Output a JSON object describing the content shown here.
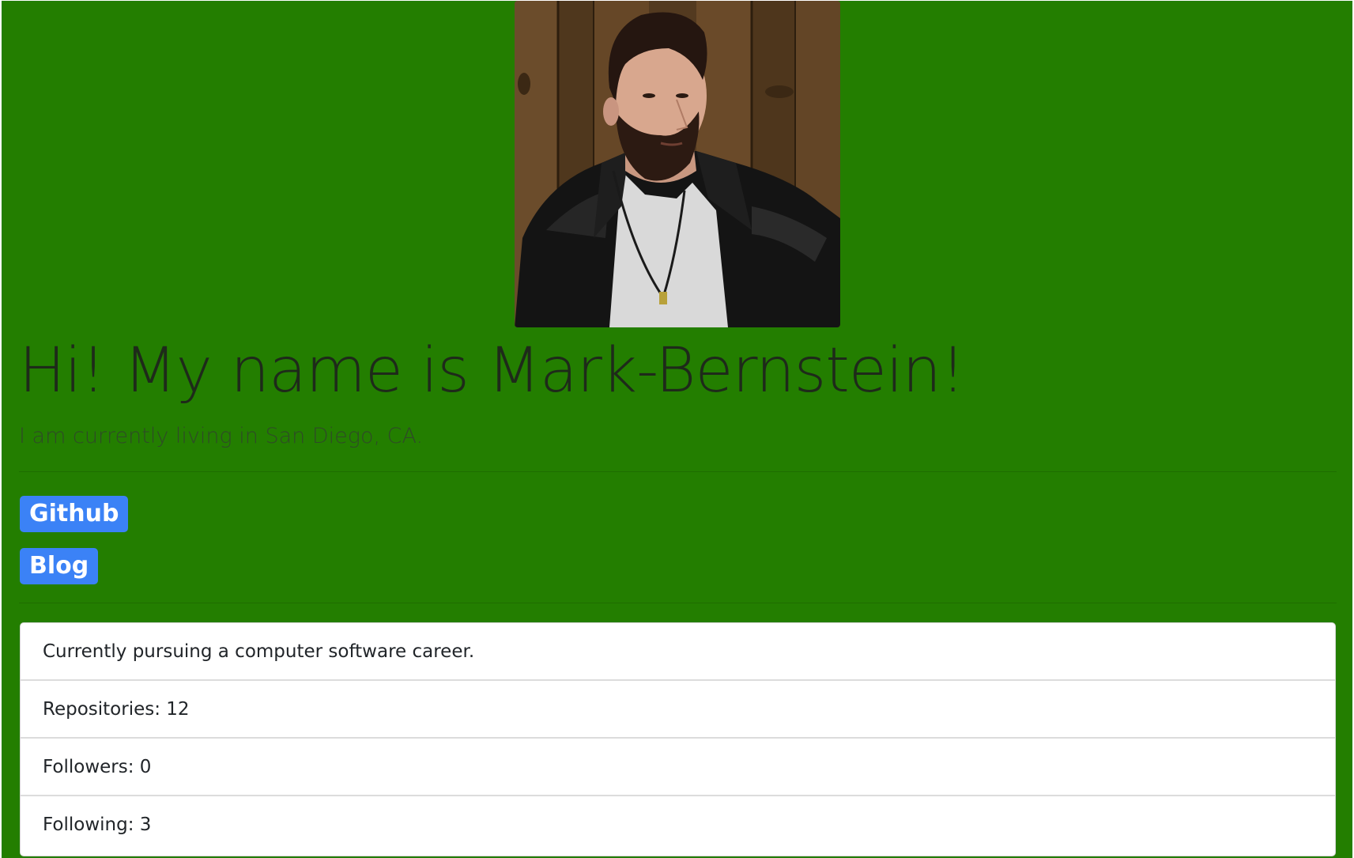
{
  "profile": {
    "photo_alt": "profile photo",
    "headline": "Hi! My name is Mark-Bernstein!",
    "location": "I am currently living in San Diego, CA."
  },
  "links": {
    "github_label": "Github",
    "blog_label": "Blog"
  },
  "details": {
    "items": [
      "Currently pursuing a computer software career.",
      "Repositories: 12",
      "Followers: 0",
      "Following: 3"
    ]
  },
  "colors": {
    "page_background": "#237e00",
    "badge_background": "#3b82f6",
    "badge_text": "#ffffff",
    "card_background": "#ffffff"
  }
}
